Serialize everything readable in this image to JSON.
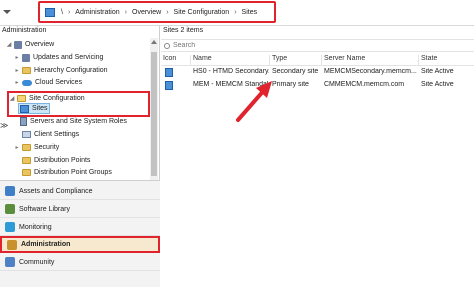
{
  "breadcrumb": {
    "root": "\\",
    "items": [
      "Administration",
      "Overview",
      "Site Configuration",
      "Sites"
    ]
  },
  "nav": {
    "title": "Administration",
    "items": [
      {
        "label": "Overview"
      },
      {
        "label": "Updates and Servicing"
      },
      {
        "label": "Hierarchy Configuration"
      },
      {
        "label": "Cloud Services"
      },
      {
        "label": "Site Configuration"
      },
      {
        "label": "Sites"
      },
      {
        "label": "Servers and Site System Roles"
      },
      {
        "label": "Client Settings"
      },
      {
        "label": "Security"
      },
      {
        "label": "Distribution Points"
      },
      {
        "label": "Distribution Point Groups"
      }
    ]
  },
  "workspaces": [
    {
      "label": "Assets and Compliance",
      "color": "#3f7fc8"
    },
    {
      "label": "Software Library",
      "color": "#5a8e3c"
    },
    {
      "label": "Monitoring",
      "color": "#2f9bd6"
    },
    {
      "label": "Administration",
      "color": "#c9912b"
    },
    {
      "label": "Community",
      "color": "#4f82c4"
    }
  ],
  "content": {
    "title": "Sites 2 items",
    "search_placeholder": "Search",
    "columns": [
      "Icon",
      "Name",
      "Type",
      "Server Name",
      "State"
    ],
    "rows": [
      {
        "name": "HS0 - HTMD Secondary...",
        "type": "Secondary site",
        "server": "MEMCMSecondary.memcm...",
        "state": "Site Active"
      },
      {
        "name": "MEM - MEMCM Standal...",
        "type": "Primary site",
        "server": "CMMEMCM.memcm.com",
        "state": "Site Active"
      }
    ]
  },
  "colors": {
    "highlight": "#e0232c",
    "selection": "#cde6f7"
  }
}
